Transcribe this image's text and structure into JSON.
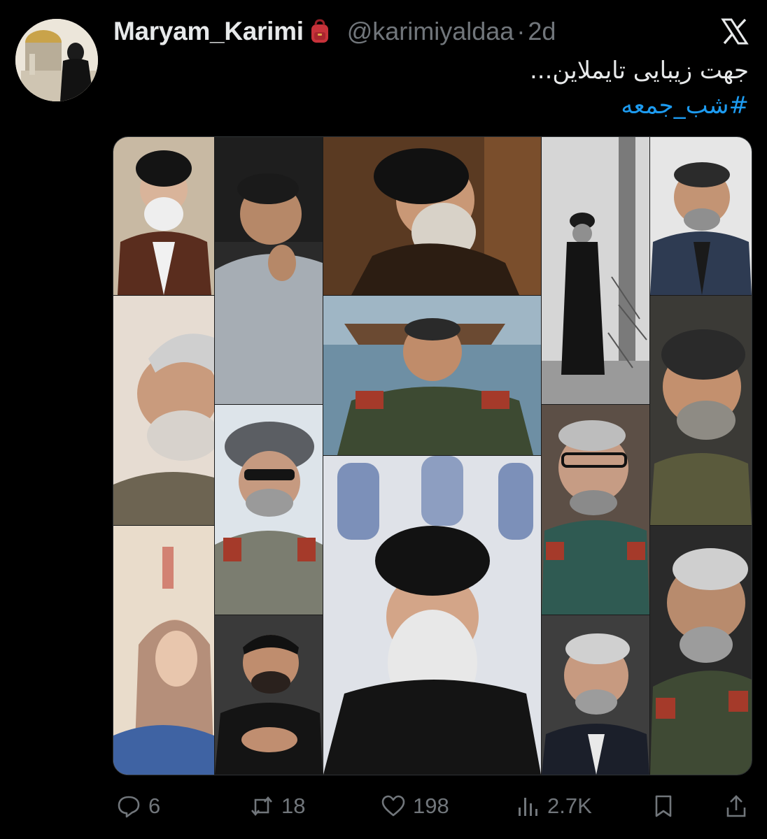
{
  "author": {
    "display_name": "Maryam_Karimi",
    "name_emoji": "backpack-icon",
    "handle": "@karimiyaldaa",
    "separator": "·",
    "timestamp": "2d"
  },
  "platform_logo": "x-logo-icon",
  "tweet": {
    "text_line": "جهت زیبایی تایملاین...",
    "hashtag": "#شب_جمعه"
  },
  "media": {
    "description_icon": "photo-collage"
  },
  "actions": {
    "replies": "6",
    "reposts": "18",
    "likes": "198",
    "views": "2.7K"
  },
  "colors": {
    "background": "#000000",
    "text": "#e7e9ea",
    "muted": "#71767b",
    "accent": "#1d9bf0"
  }
}
